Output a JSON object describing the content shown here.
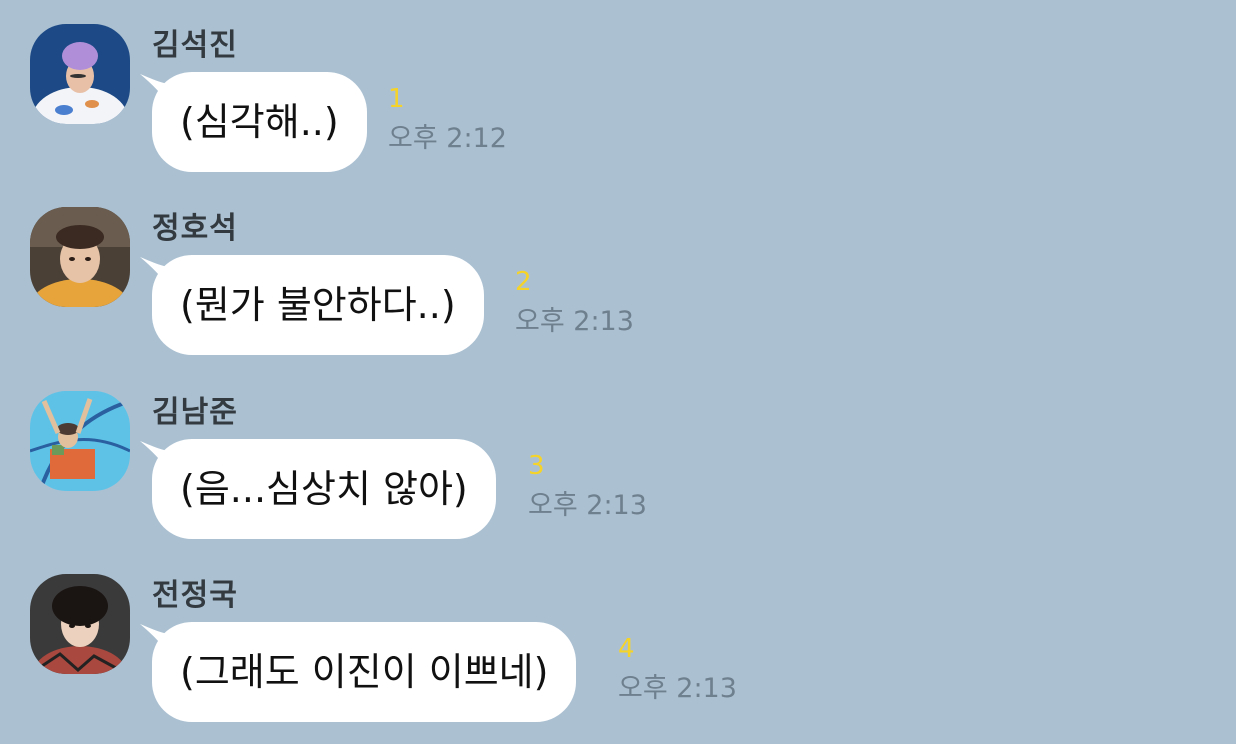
{
  "chat": {
    "background_color": "#abc1d2",
    "unread_color": "#f5d328",
    "messages": [
      {
        "sender": "김석진",
        "text": "(심각해..)",
        "unread": "1",
        "time": "오후 2:12",
        "avatar_icon": "profile-photo-icon"
      },
      {
        "sender": "정호석",
        "text": "(뭔가 불안하다..)",
        "unread": "2",
        "time": "오후 2:13",
        "avatar_icon": "profile-photo-icon"
      },
      {
        "sender": "김남준",
        "text": "(음...심상치 않아)",
        "unread": "3",
        "time": "오후 2:13",
        "avatar_icon": "profile-photo-icon"
      },
      {
        "sender": "전정국",
        "text": "(그래도 이진이 이쁘네)",
        "unread": "4",
        "time": "오후 2:13",
        "avatar_icon": "profile-photo-icon"
      }
    ]
  }
}
